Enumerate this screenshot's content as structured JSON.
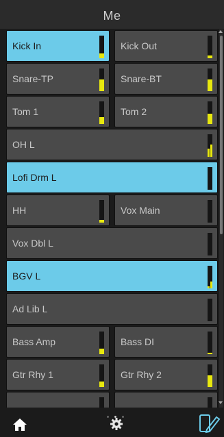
{
  "header": {
    "title": "Me"
  },
  "channels": [
    {
      "label": "Kick In",
      "selected": true,
      "level": 0.2
    },
    {
      "label": "Kick Out",
      "selected": false,
      "level": 0.12
    },
    {
      "label": "Snare-TP",
      "selected": false,
      "level": 0.5
    },
    {
      "label": "Snare-BT",
      "selected": false,
      "level": 0.5
    },
    {
      "label": "Tom 1",
      "selected": false,
      "level": 0.3
    },
    {
      "label": "Tom 2",
      "selected": false,
      "level": 0.45
    },
    {
      "label": "OH L",
      "selected": false,
      "level": 0.35,
      "level2": 0.55
    },
    {
      "label": "Lofi Drm L",
      "selected": true,
      "level": 0
    },
    {
      "label": "HH",
      "selected": false,
      "level": 0.12
    },
    {
      "label": "Vox Main",
      "selected": false,
      "level": 0
    },
    {
      "label": "Vox Dbl L",
      "selected": false,
      "level": 0
    },
    {
      "label": "BGV L",
      "selected": true,
      "level": 0.08,
      "level2": 0.3
    },
    {
      "label": "Ad Lib L",
      "selected": false,
      "level": 0
    },
    {
      "label": "Bass Amp",
      "selected": false,
      "level": 0.25
    },
    {
      "label": "Bass DI",
      "selected": false,
      "level": 0.05
    },
    {
      "label": "Gtr Rhy 1",
      "selected": false,
      "level": 0.25
    },
    {
      "label": "Gtr Rhy 2",
      "selected": false,
      "level": 0.5
    },
    {
      "label": "",
      "selected": false,
      "level": 0
    },
    {
      "label": "",
      "selected": false,
      "level": 0
    }
  ],
  "layout_rows": [
    [
      "0",
      "1"
    ],
    [
      "2",
      "3"
    ],
    [
      "4",
      "5"
    ],
    [
      "6"
    ],
    [
      "7"
    ],
    [
      "8",
      "9"
    ],
    [
      "10"
    ],
    [
      "11"
    ],
    [
      "12"
    ],
    [
      "13",
      "14"
    ],
    [
      "15",
      "16"
    ],
    [
      "17",
      "18"
    ]
  ],
  "pager": {
    "pages": 3,
    "current": 1
  },
  "tabbar": {
    "items": [
      "home-icon",
      "gear-icon",
      "device-edit-icon"
    ]
  },
  "colors": {
    "selected": "#6ccbe9",
    "meter": "#e8e80e",
    "tile": "#4a4a4a"
  }
}
